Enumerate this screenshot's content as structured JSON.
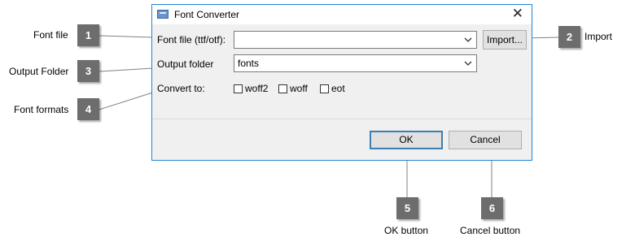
{
  "dialog": {
    "title": "Font Converter",
    "icon": "font-converter-app-icon",
    "close_glyph": "✕",
    "font_file": {
      "label": "Font file (ttf/otf):",
      "value": ""
    },
    "import_label": "Import...",
    "output_folder": {
      "label": "Output folder",
      "value": "fonts"
    },
    "convert_to": {
      "label": "Convert to:",
      "options": [
        {
          "label": "woff2",
          "checked": false
        },
        {
          "label": "woff",
          "checked": false
        },
        {
          "label": "eot",
          "checked": false
        }
      ]
    },
    "ok_label": "OK",
    "cancel_label": "Cancel"
  },
  "callouts": [
    {
      "number": "1",
      "text": "Font file"
    },
    {
      "number": "2",
      "text": "Import"
    },
    {
      "number": "3",
      "text": "Output Folder"
    },
    {
      "number": "4",
      "text": "Font formats"
    },
    {
      "number": "5",
      "text": "OK button"
    },
    {
      "number": "6",
      "text": "Cancel button"
    }
  ],
  "colors": {
    "accent_border": "#1f86d6",
    "default_button_border": "#3c7fb1",
    "badge": "#6d6d6d",
    "dialog_bg": "#f0f0f0"
  }
}
